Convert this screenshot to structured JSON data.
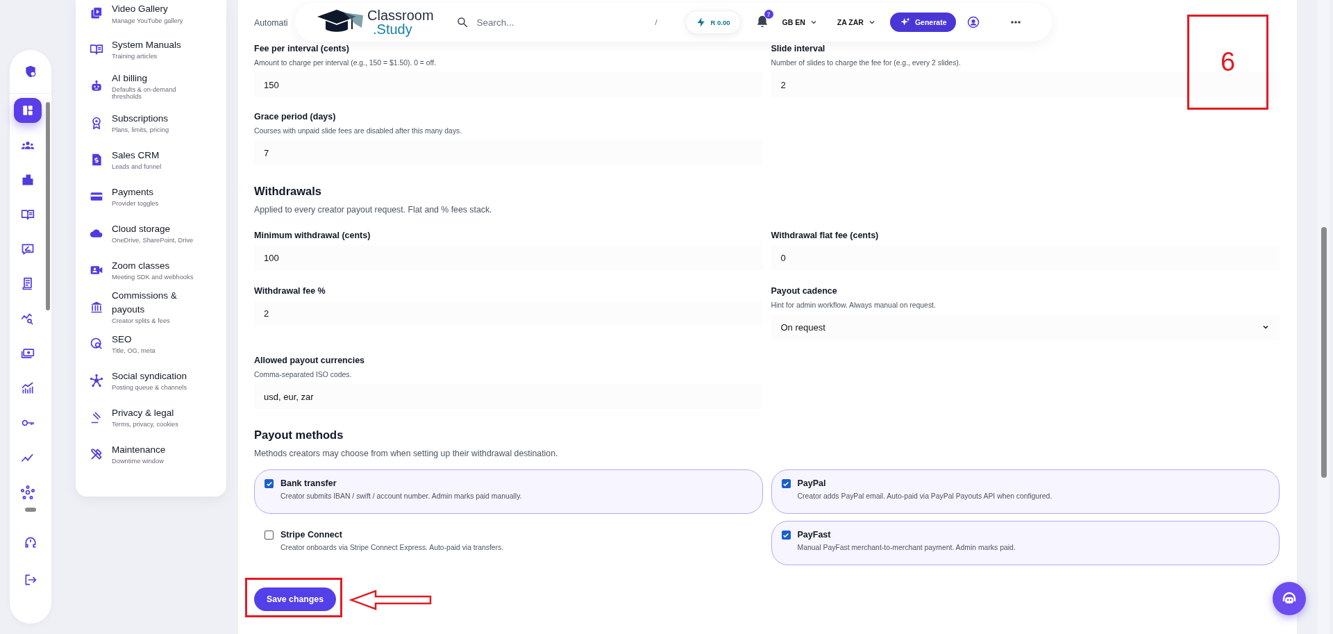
{
  "rail": {
    "items": [
      {
        "selected": false
      },
      {
        "selected": true
      },
      {
        "selected": false
      },
      {
        "selected": false
      },
      {
        "selected": false
      },
      {
        "selected": false
      },
      {
        "selected": false
      },
      {
        "selected": false
      },
      {
        "selected": false
      },
      {
        "selected": false
      },
      {
        "selected": false
      },
      {
        "selected": false
      },
      {
        "selected": false
      },
      {
        "selected": false
      },
      {
        "selected": false
      }
    ]
  },
  "sidebar": {
    "items": [
      {
        "title": "Video Gallery",
        "subtitle": "Manage YouTube gallery"
      },
      {
        "title": "System Manuals",
        "subtitle": "Training articles"
      },
      {
        "title": "AI billing",
        "subtitle": "Defaults & on-demand thresholds"
      },
      {
        "title": "Subscriptions",
        "subtitle": "Plans, limits, pricing"
      },
      {
        "title": "Sales CRM",
        "subtitle": "Leads and funnel"
      },
      {
        "title": "Payments",
        "subtitle": "Provider toggles"
      },
      {
        "title": "Cloud storage",
        "subtitle": "OneDrive, SharePoint, Drive"
      },
      {
        "title": "Zoom classes",
        "subtitle": "Meeting SDK and webhooks"
      },
      {
        "title": "Commissions & payouts",
        "subtitle": "Creator splits & fees"
      },
      {
        "title": "SEO",
        "subtitle": "Title, OG, meta"
      },
      {
        "title": "Social syndication",
        "subtitle": "Posting queue & channels"
      },
      {
        "title": "Privacy & legal",
        "subtitle": "Terms, privacy, cookies"
      },
      {
        "title": "Maintenance",
        "subtitle": "Downtime window"
      }
    ]
  },
  "header": {
    "logo_line_1": "Classroom",
    "logo_line_2": ".Study",
    "search": {
      "placeholder": "Search...",
      "shortcut": "/"
    },
    "credit": "R 0.00",
    "notifications": "7",
    "language": "GB EN",
    "currency": "ZA ZAR",
    "generate": "Generate"
  },
  "slide_fee": {
    "description_parts": [
      "Automati"
    ],
    "fields": [
      {
        "label": "Fee per interval (cents)",
        "hint": "Amount to charge per interval (e.g., 150 = $1.50). 0 = off.",
        "value": "150"
      },
      {
        "label": "Slide interval",
        "hint": "Number of slides to charge the fee for (e.g., every 2 slides).",
        "value": "2"
      },
      {
        "label": "Grace period (days)",
        "hint": "Courses with unpaid slide fees are disabled after this many days.",
        "value": "7"
      }
    ]
  },
  "withdrawals": {
    "title": "Withdrawals",
    "description": "Applied to every creator payout request. Flat and % fees stack.",
    "fields": [
      {
        "kind": "input",
        "label": "Minimum withdrawal (cents)",
        "value": "100"
      },
      {
        "kind": "input",
        "label": "Withdrawal flat fee (cents)",
        "value": "0"
      },
      {
        "kind": "input",
        "label": "Withdrawal fee %",
        "value": "2"
      },
      {
        "kind": "select",
        "label": "Payout cadence",
        "hint": "Hint for admin workflow. Always manual on request.",
        "value": "On request"
      },
      {
        "kind": "input",
        "label": "Allowed payout currencies",
        "hint": "Comma-separated ISO codes.",
        "value": "usd, eur, zar"
      }
    ]
  },
  "payout_methods": {
    "title": "Payout methods",
    "description": "Methods creators may choose from when setting up their withdrawal destination.",
    "methods": [
      {
        "name": "Bank transfer",
        "description": "Creator submits IBAN / swift / account number. Admin marks paid manually.",
        "checked": true
      },
      {
        "name": "PayPal",
        "description": "Creator adds PayPal email. Auto-paid via PayPal Payouts API when configured.",
        "checked": true
      },
      {
        "name": "Stripe Connect",
        "description": "Creator onboards via Stripe Connect Express. Auto-paid via transfers.",
        "checked": false
      },
      {
        "name": "PayFast",
        "description": "Manual PayFast merchant-to-merchant payment. Admin marks paid.",
        "checked": true
      }
    ]
  },
  "save_button": {
    "label": "Save changes",
    "highlighted": true
  },
  "annotation": {
    "step_number": "6"
  }
}
